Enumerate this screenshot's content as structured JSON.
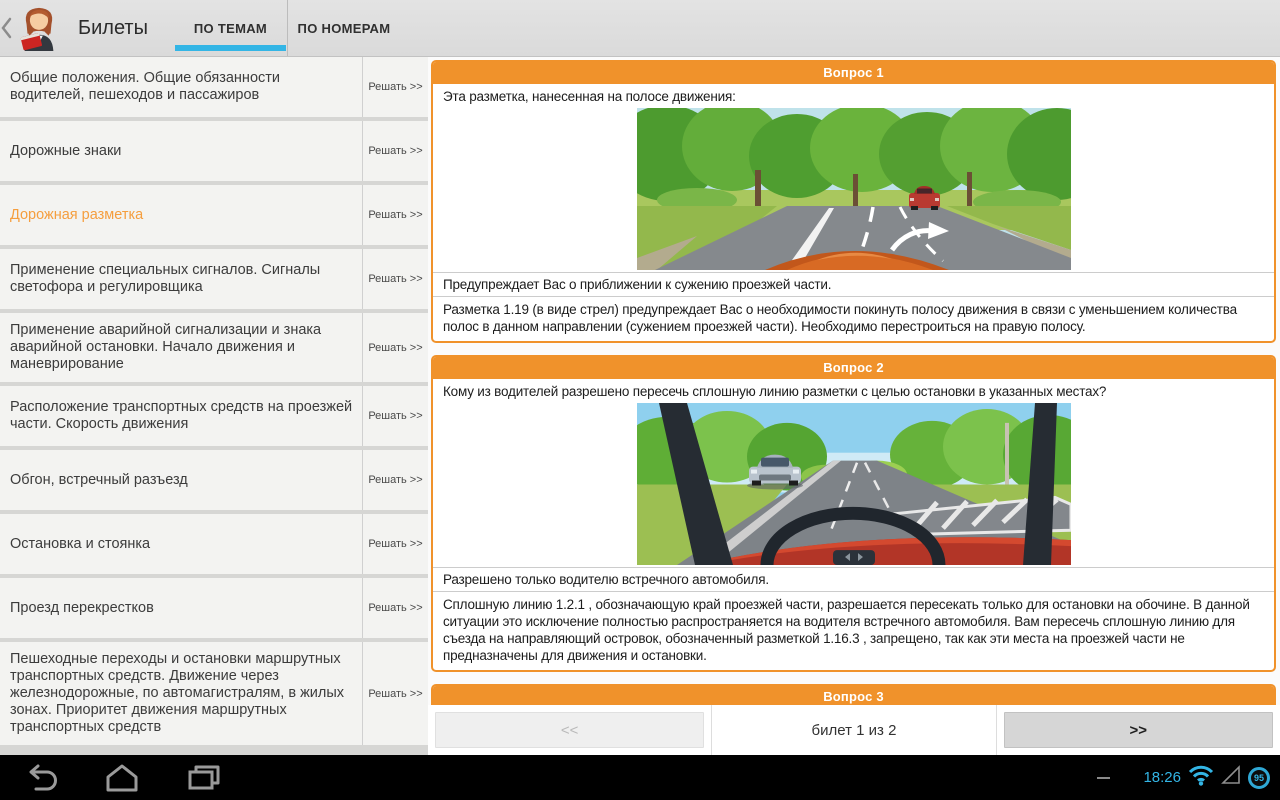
{
  "app": {
    "title": "Билеты",
    "tabs": [
      {
        "label": "ПО ТЕМАМ",
        "active": true
      },
      {
        "label": "ПО НОМЕРАМ",
        "active": false
      }
    ],
    "accent_orange": "#F0922B",
    "accent_blue": "#33B5E5"
  },
  "sidebar": {
    "solve_label": "Решать >>",
    "active_index": 2,
    "items": [
      {
        "label": "Общие положения. Общие обязанности водителей, пешеходов и пассажиров"
      },
      {
        "label": "Дорожные знаки"
      },
      {
        "label": "Дорожная разметка"
      },
      {
        "label": "Применение специальных сигналов. Сигналы светофора и регулировщика"
      },
      {
        "label": "Применение аварийной сигнализации и знака аварийной остановки. Начало движения и маневрирование"
      },
      {
        "label": "Расположение транспортных средств на проезжей части. Скорость движения"
      },
      {
        "label": "Обгон, встречный разъезд"
      },
      {
        "label": "Остановка и стоянка"
      },
      {
        "label": "Проезд перекрестков"
      },
      {
        "label": "Пешеходные переходы и остановки маршрутных транспортных средств. Движение через железнодорожные, по автомагистралям, в жилых зонах. Приоритет движения маршрутных транспортных средств"
      }
    ]
  },
  "main": {
    "questions": [
      {
        "header": "Вопрос 1",
        "question": "Эта разметка, нанесенная на полосе движения:",
        "image_alt": "Вид с места водителя: дорога в лесу, красный автомобиль впереди, разметка-стрела на полосе",
        "answer": "Предупреждает Вас о приближении к сужению проезжей части.",
        "explanation": "Разметка 1.19 (в виде стрел) предупреждает Вас о необходимости покинуть полосу движения в связи с уменьшением количества полос в данном направлении (сужением проезжей части). Необходимо перестроиться на правую полосу."
      },
      {
        "header": "Вопрос 2",
        "question": "Кому из водителей разрешено пересечь сплошную линию разметки с целью остановки в указанных местах?",
        "image_alt": "Вид из салона: встречный серебристый автомобиль слева, направляющий островок с разметкой справа",
        "answer": "Разрешено только водителю встречного автомобиля.",
        "explanation": "Сплошную линию 1.2.1 , обозначающую край проезжей части, разрешается пересекать только для остановки на обочине. В данной ситуации это исключение полностью распространяется на водителя встречного автомобиля. Вам пересечь сплошную линию для съезда на направляющий островок, обозначенный разметкой 1.16.3 , запрещено, так как эти места на проезжей части не предназначены для движения и остановки."
      },
      {
        "header": "Вопрос 3"
      }
    ],
    "pagination": {
      "prev": "<<",
      "label": "билет 1 из 2",
      "next": ">>"
    }
  },
  "system_bar": {
    "time": "18:26",
    "battery": "95"
  }
}
